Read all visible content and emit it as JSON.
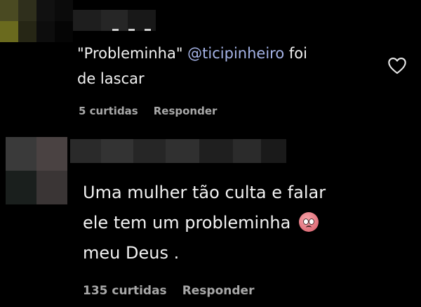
{
  "colors": {
    "background": "#000000",
    "text": "#f2f2f2",
    "mention": "#a5b3e6",
    "secondary": "#a8a8a8"
  },
  "comments": [
    {
      "quote": "\"Probleminha\" ",
      "mention": "@ticipinheiro",
      "text_after": " foi\nde lascar",
      "likes": "5 curtidas",
      "reply_label": "Responder",
      "like_icon": "heart-outline-icon"
    },
    {
      "text": "Uma mulher tão culta e falar\nele tem um probleminha ",
      "text_end": "\nmeu Deus .",
      "emoji": "pleading-face-emoji",
      "likes": "135 curtidas",
      "reply_label": "Responder"
    }
  ]
}
